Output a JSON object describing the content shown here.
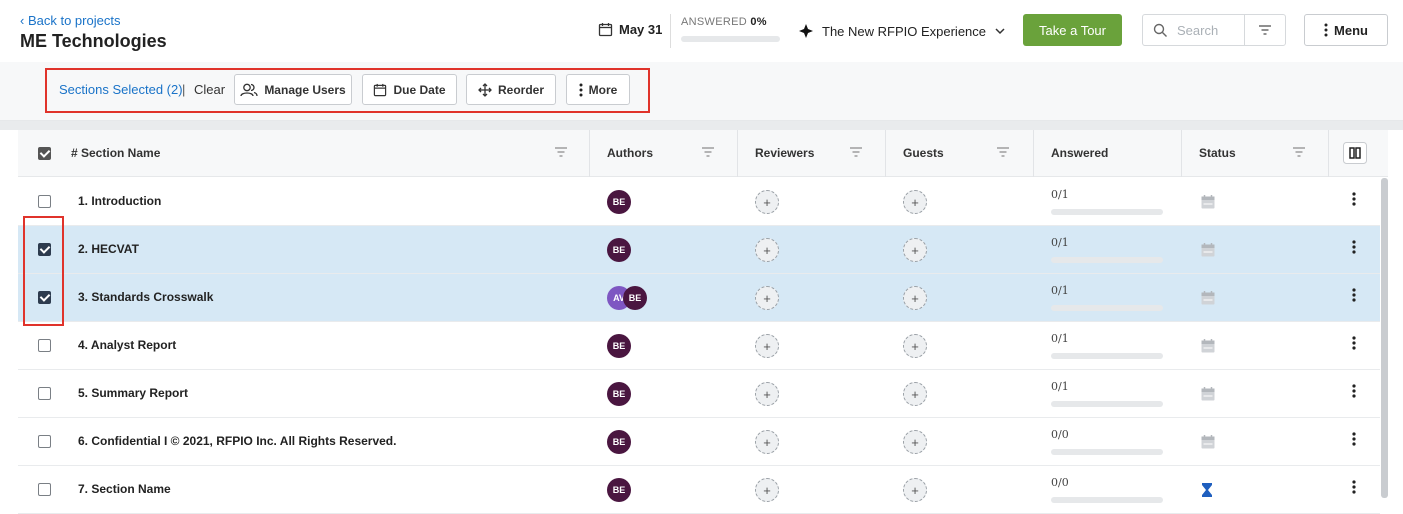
{
  "header": {
    "back_label": "Back to projects",
    "project_name": "ME Technologies",
    "due_date": "May 31",
    "answered_label": "ANSWERED",
    "answered_pct": "0%",
    "answered_fraction": 0,
    "experience_label": "The New RFPIO Experience",
    "tour_label": "Take a Tour",
    "search_placeholder": "Search",
    "menu_label": "Menu"
  },
  "actionbar": {
    "selected_label": "Sections Selected (2)",
    "separator": "|",
    "clear_label": "Clear",
    "buttons": [
      "Manage Users",
      "Due Date",
      "Reorder",
      "More"
    ]
  },
  "table": {
    "columns": [
      "# Section Name",
      "Authors",
      "Reviewers",
      "Guests",
      "Answered",
      "Status"
    ],
    "rows": [
      {
        "name": "1. Introduction",
        "selected": false,
        "authors": [
          "BE"
        ],
        "answered": "0/1",
        "status": "calendar-icon"
      },
      {
        "name": "2. HECVAT",
        "selected": true,
        "authors": [
          "BE"
        ],
        "answered": "0/1",
        "status": "calendar-icon"
      },
      {
        "name": "3. Standards Crosswalk",
        "selected": true,
        "authors": [
          "AV",
          "BE"
        ],
        "answered": "0/1",
        "status": "calendar-icon"
      },
      {
        "name": "4. Analyst Report",
        "selected": false,
        "authors": [
          "BE"
        ],
        "answered": "0/1",
        "status": "calendar-icon"
      },
      {
        "name": "5. Summary Report",
        "selected": false,
        "authors": [
          "BE"
        ],
        "answered": "0/1",
        "status": "calendar-icon"
      },
      {
        "name": "6. Confidential I © 2021, RFPIO Inc. All Rights Reserved.",
        "selected": false,
        "authors": [
          "BE"
        ],
        "answered": "0/0",
        "status": "calendar-icon"
      },
      {
        "name": "7. Section Name",
        "selected": false,
        "authors": [
          "BE"
        ],
        "answered": "0/0",
        "status": "hourglass-icon"
      }
    ]
  },
  "colors": {
    "accent_blue": "#1a73c8",
    "tour_green": "#6aa23b",
    "selected_row": "#d6e8f5",
    "highlight_red": "#e0332b",
    "avatar_dark": "#4a1640",
    "avatar_purple": "#7e57c2",
    "hourglass_blue": "#1f5fbf"
  }
}
